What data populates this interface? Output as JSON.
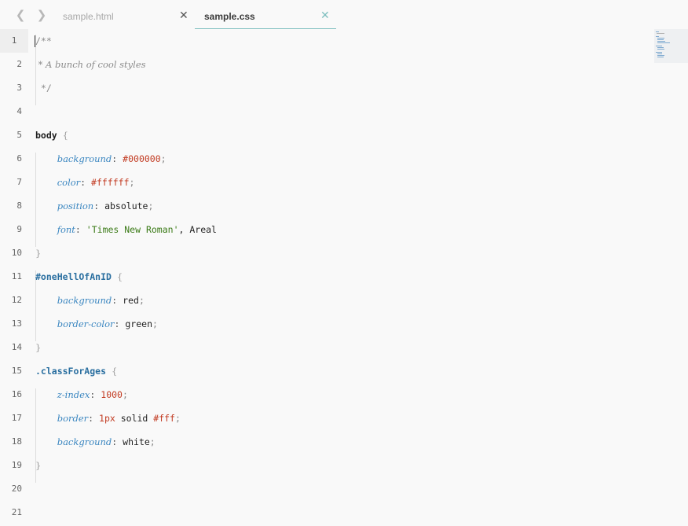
{
  "tabs": [
    {
      "label": "sample.html",
      "active": false
    },
    {
      "label": "sample.css",
      "active": true
    }
  ],
  "close_glyph": "✕",
  "nav": {
    "back_icon": "chevron-left-icon",
    "forward_icon": "chevron-right-icon"
  },
  "line_numbers": [
    "1",
    "2",
    "3",
    "4",
    "5",
    "6",
    "7",
    "8",
    "9",
    "10",
    "11",
    "12",
    "13",
    "14",
    "15",
    "16",
    "17",
    "18",
    "19",
    "20",
    "21"
  ],
  "code": {
    "l1": "/**",
    "l2": " * A bunch of cool styles",
    "l3": " */",
    "l5_sel": "body",
    "l6_prop": "background",
    "l6_val": "#000000",
    "l7_prop": "color",
    "l7_val": "#ffffff",
    "l8_prop": "position",
    "l8_val": "absolute",
    "l9_prop": "font",
    "l9_str": "'Times New Roman'",
    "l9_rest": ", Areal",
    "l11_sel": "#oneHellOfAnID",
    "l12_prop": "background",
    "l12_val": "red",
    "l13_prop": "border-color",
    "l13_val": "green",
    "l15_sel": ".classForAges",
    "l16_prop": "z-index",
    "l16_val": "1000",
    "l17_prop": "border",
    "l17_num": "1px",
    "l17_kw": " solid ",
    "l17_col": "#fff",
    "l18_prop": "background",
    "l18_val": "white",
    "open_brace": "{",
    "close_brace": "}",
    "colon": ":",
    "semi": ";"
  },
  "colors": {
    "accent": "#7fbfbf",
    "property": "#3a86c0",
    "value_color": "#c23b22",
    "string": "#3a7a16",
    "selector": "#2a6fa0"
  }
}
